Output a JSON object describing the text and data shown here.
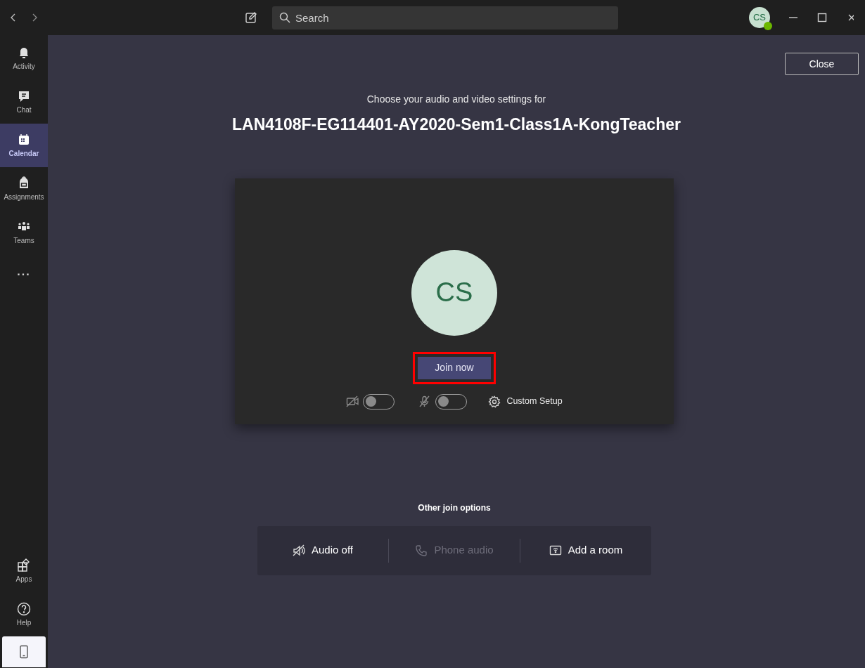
{
  "title_bar": {
    "search": {
      "placeholder": "Search"
    },
    "avatar": {
      "initials": "CS",
      "online": true
    }
  },
  "sidebar": {
    "items": [
      {
        "label": "Activity",
        "selected": false
      },
      {
        "label": "Chat",
        "selected": false
      },
      {
        "label": "Calendar",
        "selected": true
      },
      {
        "label": "Assignments",
        "selected": false
      },
      {
        "label": "Teams",
        "selected": false
      }
    ],
    "more": "...",
    "bottom_items": [
      {
        "label": "Apps"
      },
      {
        "label": "Help"
      }
    ]
  },
  "close_button": "Close",
  "heading": {
    "subtitle": "Choose your audio and video settings for",
    "meeting_name": "LAN4108F-EG114401-AY2020-Sem1-Class1A-KongTeacher"
  },
  "preview": {
    "avatar_initials": "CS",
    "join_button": "Join now",
    "highlighted": true,
    "controls": [
      {
        "kind": "camera",
        "on": false
      },
      {
        "kind": "mic",
        "on": false
      }
    ],
    "custom_setup": "Custom Setup"
  },
  "other_options": {
    "title": "Other join options",
    "options": [
      {
        "kind": "audio_off",
        "label": "Audio off",
        "disabled": false
      },
      {
        "kind": "phone",
        "label": "Phone audio",
        "disabled": true
      },
      {
        "kind": "room",
        "label": "Add a room",
        "disabled": false
      }
    ]
  }
}
